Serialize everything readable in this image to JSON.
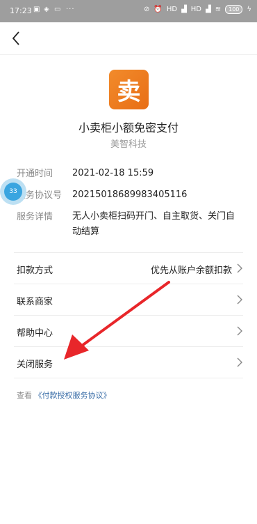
{
  "status_bar": {
    "time": "17:23",
    "icons": [
      "sim-icon",
      "shield-icon",
      "mail-icon",
      "more-dots-icon"
    ],
    "more": "···",
    "signal1": "HD",
    "signal2": "HD",
    "battery": "100"
  },
  "service": {
    "icon_char": "卖",
    "title": "小卖柜小额免密支付",
    "merchant": "美智科技"
  },
  "details": [
    {
      "label": "开通时间",
      "value": "2021-02-18 15:59"
    },
    {
      "label": "服务协议号",
      "value": "20215018689983405116"
    },
    {
      "label": "服务详情",
      "value": "无人小卖柜扫码开门、自主取货、关门自动结算"
    }
  ],
  "float_bubble": {
    "text": "33"
  },
  "menu": [
    {
      "label": "扣款方式",
      "value": "优先从账户余额扣款"
    },
    {
      "label": "联系商家",
      "value": ""
    },
    {
      "label": "帮助中心",
      "value": ""
    },
    {
      "label": "关闭服务",
      "value": ""
    }
  ],
  "agreement": {
    "prefix": "查看",
    "link": "《付款授权服务协议》"
  },
  "colors": {
    "accent_red": "#e8262a",
    "icon_orange": "#ee7d22",
    "link_blue": "#3a6ea8"
  }
}
